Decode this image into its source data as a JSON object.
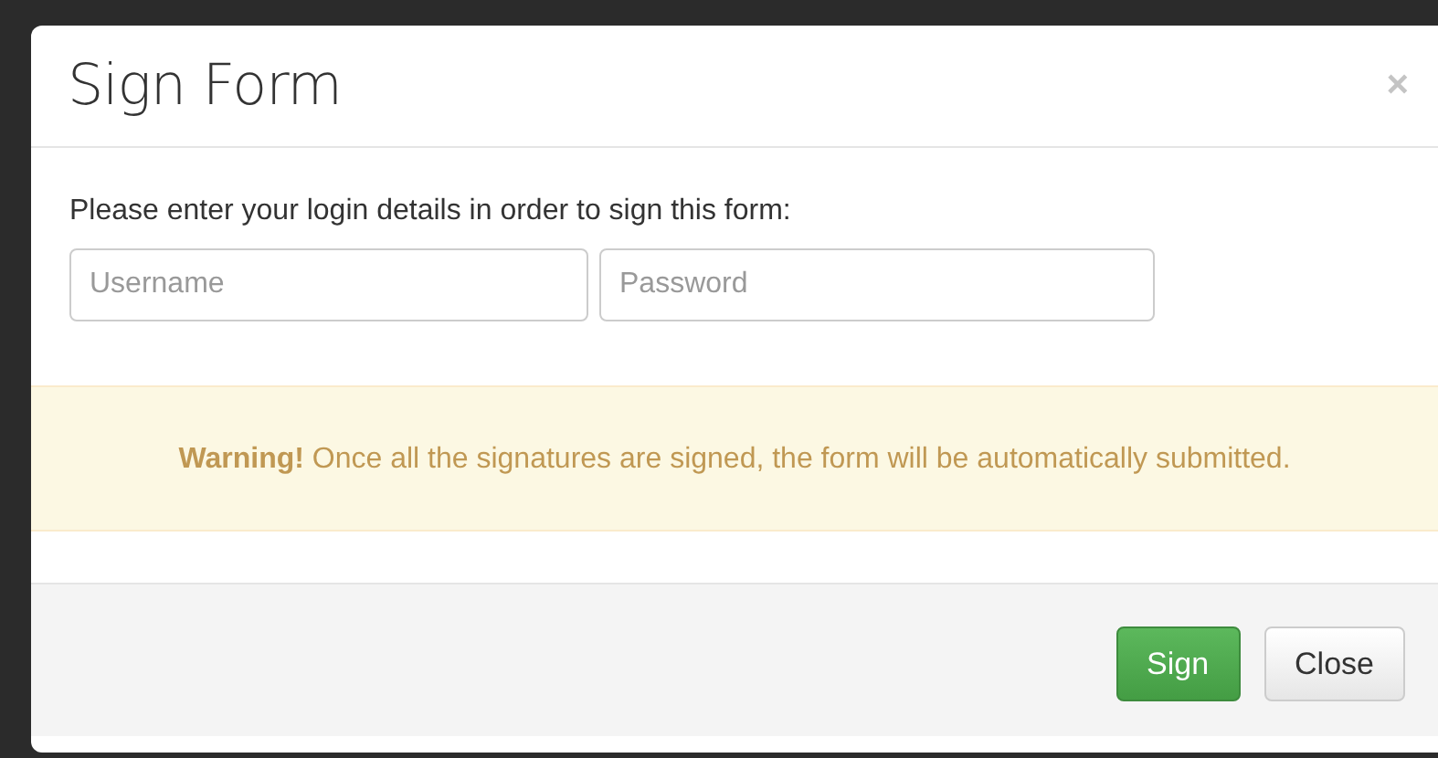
{
  "dialog": {
    "title": "Sign Form",
    "close_icon": "×",
    "instructions": "Please enter your login details in order to sign this form:",
    "fields": [
      {
        "placeholder": "Username"
      },
      {
        "placeholder": "Password"
      }
    ],
    "warning": "**Warning!** Once all the signatures are signed, the form will be automatically submitted.",
    "buttons": [
      {
        "label": "Sign",
        "kind": "primary"
      },
      {
        "label": "Close",
        "kind": "default"
      }
    ]
  }
}
